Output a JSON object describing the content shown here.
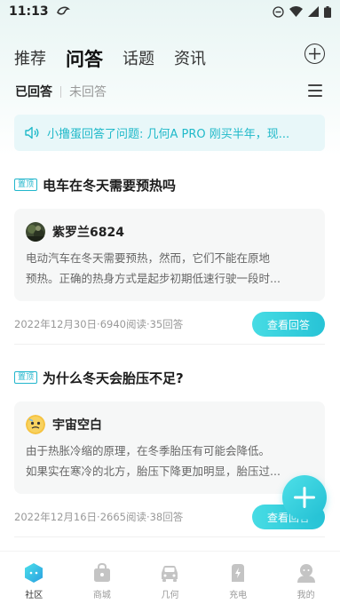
{
  "status_bar": {
    "time": "11:13"
  },
  "header": {
    "tabs": [
      {
        "label": "推荐"
      },
      {
        "label": "问答"
      },
      {
        "label": "话题"
      },
      {
        "label": "资讯"
      }
    ],
    "active_tab": "问答"
  },
  "subtabs": {
    "answered": "已回答",
    "unanswered": "未回答",
    "active": "已回答"
  },
  "notice": {
    "text": "小撸蛋回答了问题: 几何A PRO  刚买半年，现..."
  },
  "posts": [
    {
      "badge": "置顶",
      "title": "电车在冬天需要预热吗",
      "user": "紫罗兰6824",
      "answer_line1": "电动汽车在冬天需要预热，然而，它们不能在原地",
      "answer_line2": "预热。正确的热身方式是起步初期低速行驶一段时...",
      "meta": "2022年12月30日·6940阅读·35回答",
      "button": "查看回答"
    },
    {
      "badge": "置顶",
      "title": "为什么冬天会胎压不足?",
      "user": "宇宙空白",
      "answer_line1": "由于热胀冷缩的原理，在冬季胎压有可能会降低。",
      "answer_line2": "如果实在寒冷的北方，胎压下降更加明显，胎压过...",
      "meta": "2022年12月16日·2665阅读·38回答",
      "button": "查看回答"
    }
  ],
  "bottom_nav": [
    {
      "label": "社区",
      "icon": "community-icon",
      "active": true
    },
    {
      "label": "商城",
      "icon": "shop-bag-icon",
      "active": false
    },
    {
      "label": "几何",
      "icon": "car-icon",
      "active": false
    },
    {
      "label": "充电",
      "icon": "charging-station-icon",
      "active": false
    },
    {
      "label": "我的",
      "icon": "profile-icon",
      "active": false
    }
  ],
  "colors": {
    "accent": "#27c3d6",
    "notice_bg": "#e8f7f9",
    "notice_text": "#1fb9c9"
  }
}
